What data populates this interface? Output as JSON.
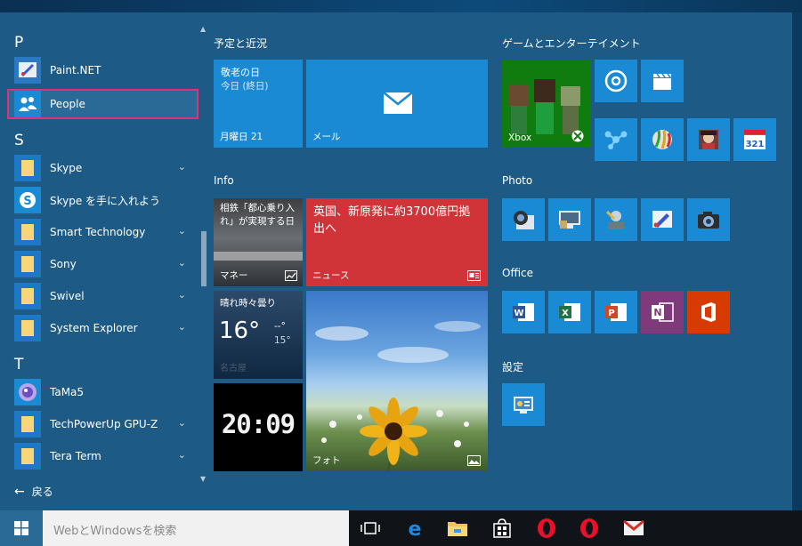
{
  "applist": {
    "letters": [
      "P",
      "S",
      "T"
    ],
    "items": [
      {
        "label": "Paint.NET"
      },
      {
        "label": "People"
      },
      {
        "label": "Skype"
      },
      {
        "label": "Skype を手に入れよう"
      },
      {
        "label": "Smart Technology"
      },
      {
        "label": "Sony"
      },
      {
        "label": "Swivel"
      },
      {
        "label": "System Explorer"
      },
      {
        "label": "TaMa5"
      },
      {
        "label": "TechPowerUp GPU-Z"
      },
      {
        "label": "Tera Term"
      }
    ],
    "back_label": "戻る"
  },
  "groups": {
    "schedule": {
      "title": "予定と近況"
    },
    "info": {
      "title": "Info"
    },
    "games": {
      "title": "ゲームとエンターテイメント"
    },
    "photo": {
      "title": "Photo"
    },
    "office": {
      "title": "Office"
    },
    "settings": {
      "title": "設定"
    }
  },
  "tiles": {
    "calendar": {
      "event": "敬老の日",
      "sub": "今日 (終日)",
      "date": "月曜日 21"
    },
    "mail": {
      "label": "メール"
    },
    "money": {
      "headline": "相鉄「都心乗り入れ」が実現する日",
      "label": "マネー"
    },
    "news": {
      "headline": "英国、新原発に約3700億円拠出へ",
      "label": "ニュース"
    },
    "weather": {
      "condition": "晴れ時々曇り",
      "temp": "16°",
      "hi": "--°",
      "lo": "15°",
      "place": "名古屋"
    },
    "clock": {
      "time": "20:09"
    },
    "photos": {
      "label": "フォト"
    },
    "xbox": {
      "label": "Xbox"
    }
  },
  "taskbar": {
    "search_placeholder": "WebとWindowsを検索"
  },
  "colors": {
    "accent": "#1b8ad4",
    "start_bg": "#1d5a86",
    "news_red": "#d13438",
    "onenote": "#80397b",
    "office": "#d83b01",
    "xbox_green": "#107c10"
  }
}
